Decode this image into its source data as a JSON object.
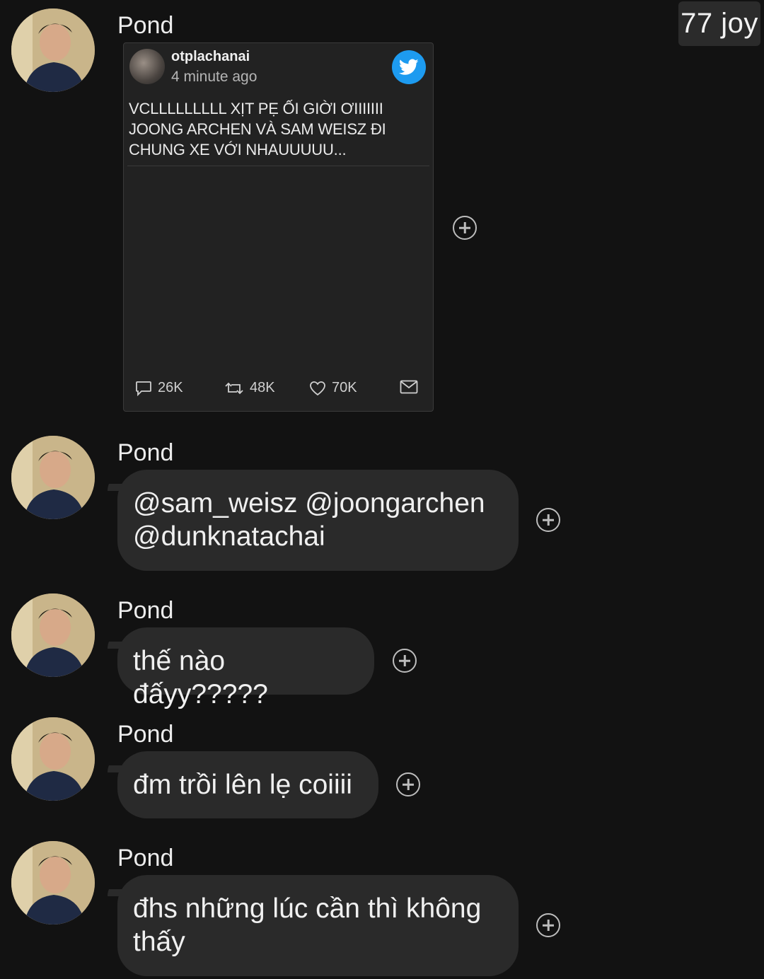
{
  "watermark": "77 joy",
  "messages": [
    {
      "sender": "Pond",
      "type": "shared_tweet",
      "tweet": {
        "username": "otplachanai",
        "time": "4 minute ago",
        "text": "VCLLLLLLLLL XỊT PẸ ỐI GIỜI ƠIIIIIII JOONG ARCHEN VÀ SAM WEISZ ĐI CHUNG XE VỚI NHAUUUUU...",
        "replies": "26K",
        "retweets": "48K",
        "likes": "70K",
        "icons": [
          "reply-icon",
          "retweet-icon",
          "heart-icon",
          "mail-icon",
          "twitter-bird-icon"
        ]
      }
    },
    {
      "sender": "Pond",
      "type": "text",
      "text": "@sam_weisz @joongarchen @dunknatachai"
    },
    {
      "sender": "Pond",
      "type": "text",
      "text": "thế nào đấyy?????"
    },
    {
      "sender": "Pond",
      "type": "text",
      "text": "đm trồi lên lẹ coiiii"
    },
    {
      "sender": "Pond",
      "type": "text",
      "text": "đhs những lúc cần thì không thấy"
    }
  ],
  "colors": {
    "background": "#121212",
    "bubble": "#2a2a2a",
    "twitter_blue": "#1d9bf0"
  }
}
